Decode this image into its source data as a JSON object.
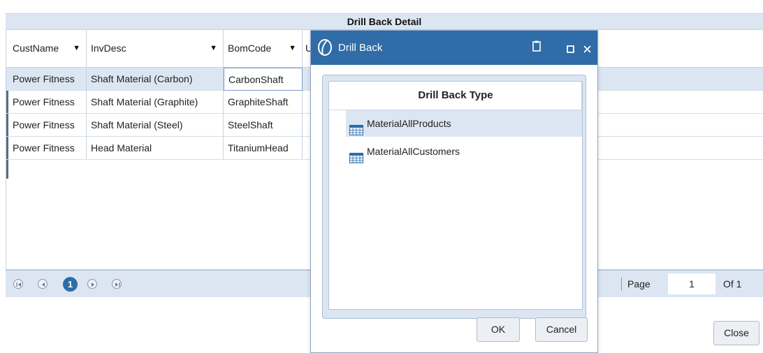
{
  "panel": {
    "title": "Drill Back Detail"
  },
  "grid": {
    "columns": [
      {
        "label": "CustName"
      },
      {
        "label": "InvDesc"
      },
      {
        "label": "BomCode"
      },
      {
        "label": "U"
      }
    ],
    "rows": [
      [
        "Power Fitness",
        "Shaft Material (Carbon)",
        "CarbonShaft"
      ],
      [
        "Power Fitness",
        "Shaft Material (Graphite)",
        "GraphiteShaft"
      ],
      [
        "Power Fitness",
        "Shaft Material (Steel)",
        "SteelShaft"
      ],
      [
        "Power Fitness",
        "Head Material",
        "TitaniumHead"
      ]
    ]
  },
  "pager": {
    "current_page": "1",
    "page_label": "Page",
    "page_value": "1",
    "of_label": "Of 1"
  },
  "close_button": "Close",
  "dialog": {
    "title": "Drill Back",
    "header": "Drill Back Type",
    "items": [
      {
        "label": "MaterialAllProducts",
        "icon": "grid-table-icon"
      },
      {
        "label": "MaterialAllCustomers",
        "icon": "grid-table-icon"
      }
    ],
    "ok": "OK",
    "cancel": "Cancel"
  },
  "colors": {
    "title_bar": "#dce6f3",
    "dialog_titlebar": "#2f6ca8",
    "selected_row": "#dce6f3",
    "current_page": "#2d6da8"
  }
}
